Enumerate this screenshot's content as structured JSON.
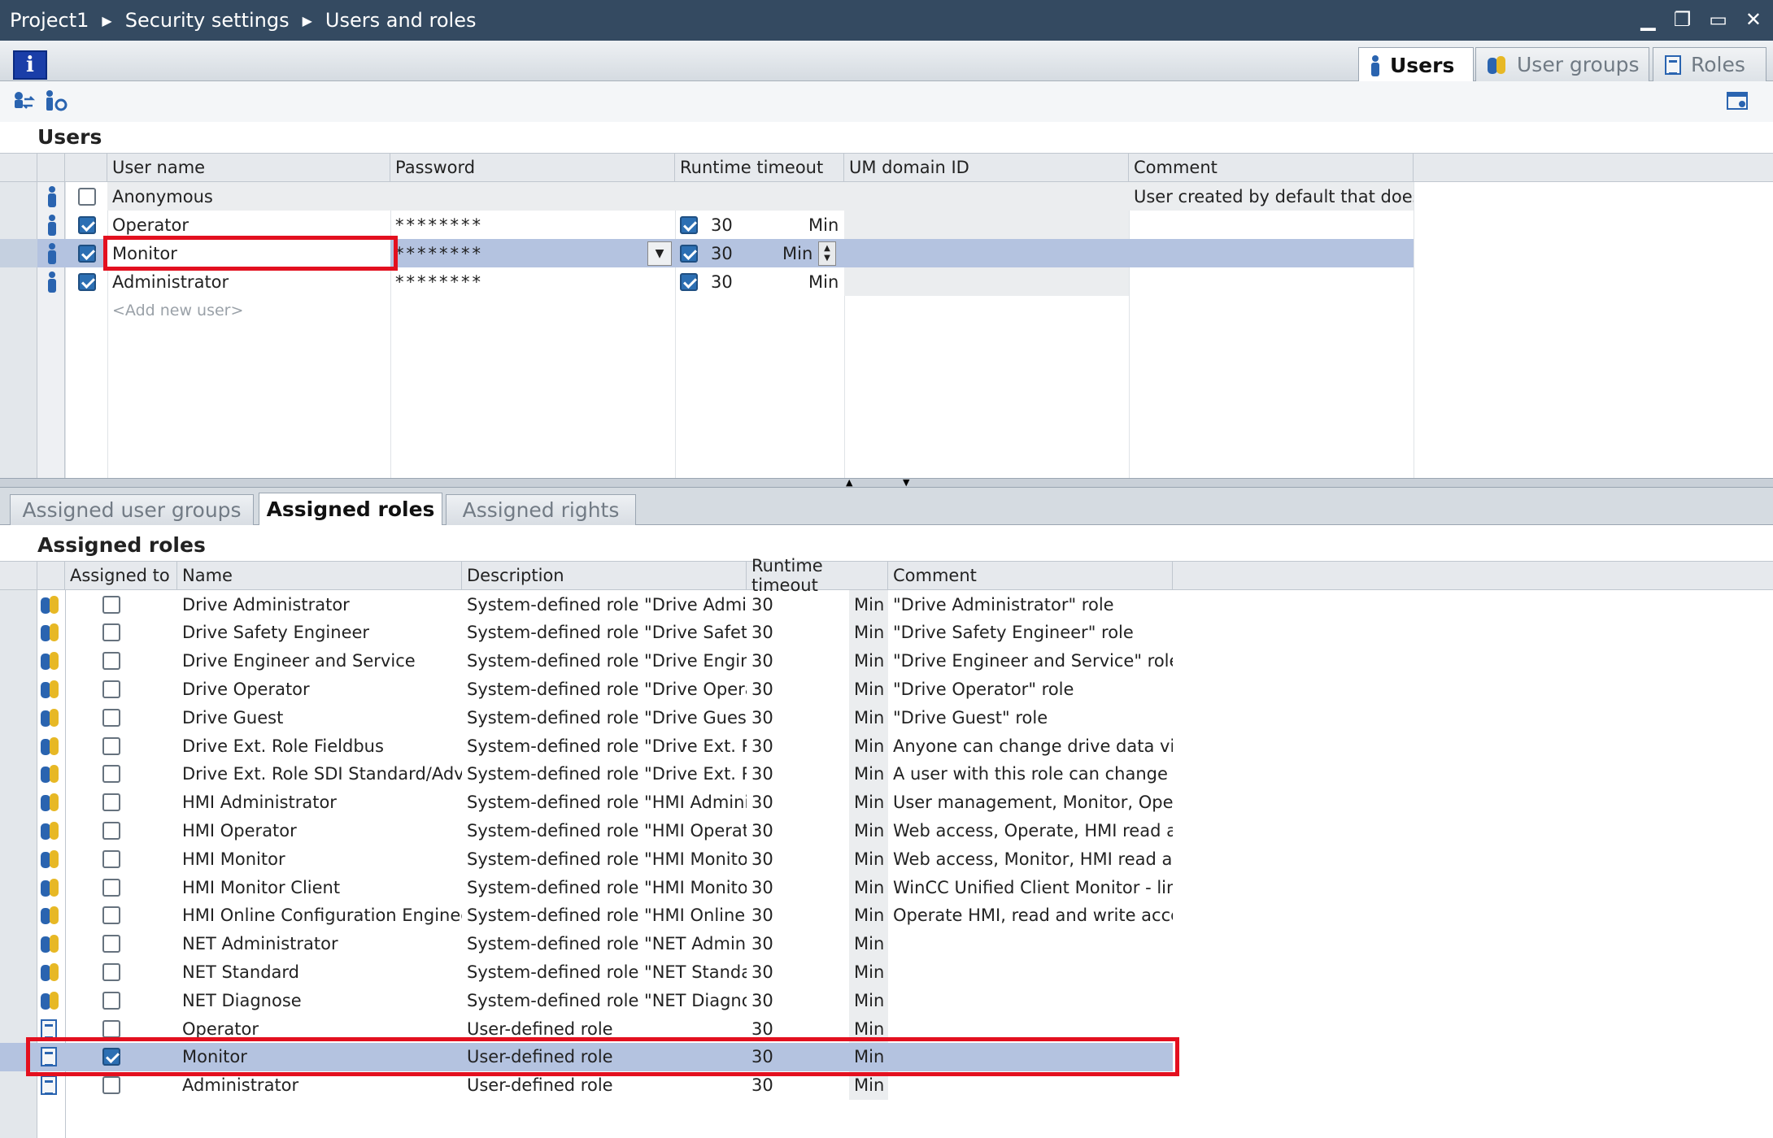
{
  "breadcrumb": [
    "Project1",
    "Security settings",
    "Users and roles"
  ],
  "window_controls": [
    "▁",
    "❐",
    "▭",
    "✕"
  ],
  "view_tabs": [
    {
      "label": "Users",
      "active": true
    },
    {
      "label": "User groups",
      "active": false
    },
    {
      "label": "Roles",
      "active": false
    }
  ],
  "info_label": "i",
  "users": {
    "title": "Users",
    "columns": [
      "User name",
      "Password",
      "Runtime timeout",
      "UM domain ID",
      "Comment"
    ],
    "rows": [
      {
        "name": "Anonymous",
        "checked": false,
        "password": "",
        "timeout_on": false,
        "timeout": "",
        "unit": "",
        "comment": "User created by default that does ..."
      },
      {
        "name": "Operator",
        "checked": true,
        "password": "********",
        "timeout_on": true,
        "timeout": "30",
        "unit": "Min",
        "comment": ""
      },
      {
        "name": "Monitor",
        "checked": true,
        "password": "********",
        "timeout_on": true,
        "timeout": "30",
        "unit": "Min",
        "comment": ""
      },
      {
        "name": "Administrator",
        "checked": true,
        "password": "********",
        "timeout_on": true,
        "timeout": "30",
        "unit": "Min",
        "comment": ""
      }
    ],
    "add_new": "<Add new user>"
  },
  "lower_tabs": [
    {
      "label": "Assigned user groups",
      "active": false
    },
    {
      "label": "Assigned roles",
      "active": true
    },
    {
      "label": "Assigned rights",
      "active": false
    }
  ],
  "roles": {
    "title": "Assigned roles",
    "columns": [
      "Assigned to",
      "Name",
      "Description",
      "Runtime timeout",
      "Comment"
    ],
    "rows": [
      {
        "icon": "system",
        "checked": false,
        "name": "Drive Administrator",
        "desc": "System-defined role \"Drive Admini...",
        "timeout": "30",
        "unit": "Min",
        "comment": "\"Drive Administrator\" role"
      },
      {
        "icon": "system",
        "checked": false,
        "name": "Drive Safety Engineer",
        "desc": "System-defined role \"Drive Safety ...",
        "timeout": "30",
        "unit": "Min",
        "comment": "\"Drive Safety Engineer\" role"
      },
      {
        "icon": "system",
        "checked": false,
        "name": "Drive Engineer and Service",
        "desc": "System-defined role \"Drive Engine...",
        "timeout": "30",
        "unit": "Min",
        "comment": "\"Drive Engineer and Service\" role"
      },
      {
        "icon": "system",
        "checked": false,
        "name": "Drive Operator",
        "desc": "System-defined role \"Drive Operat...",
        "timeout": "30",
        "unit": "Min",
        "comment": "\"Drive Operator\" role"
      },
      {
        "icon": "system",
        "checked": false,
        "name": "Drive Guest",
        "desc": "System-defined role \"Drive Guest\"",
        "timeout": "30",
        "unit": "Min",
        "comment": "\"Drive Guest\" role"
      },
      {
        "icon": "system",
        "checked": false,
        "name": "Drive Ext. Role Fieldbus",
        "desc": "System-defined role \"Drive Ext. Rol...",
        "timeout": "30",
        "unit": "Min",
        "comment": "Anyone can change drive data via..."
      },
      {
        "icon": "system",
        "checked": false,
        "name": "Drive Ext. Role SDI Standard/Adv",
        "desc": "System-defined role \"Drive Ext. Rol...",
        "timeout": "30",
        "unit": "Min",
        "comment": "A user with this role can change d..."
      },
      {
        "icon": "system",
        "checked": false,
        "name": "HMI Administrator",
        "desc": "System-defined role \"HMI Adminis...",
        "timeout": "30",
        "unit": "Min",
        "comment": "User management, Monitor, Oper..."
      },
      {
        "icon": "system",
        "checked": false,
        "name": "HMI Operator",
        "desc": "System-defined role \"HMI Operator\"",
        "timeout": "30",
        "unit": "Min",
        "comment": "Web access, Operate, HMI read an..."
      },
      {
        "icon": "system",
        "checked": false,
        "name": "HMI Monitor",
        "desc": "System-defined role \"HMI Monitor\"",
        "timeout": "30",
        "unit": "Min",
        "comment": "Web access, Monitor, HMI read ac..."
      },
      {
        "icon": "system",
        "checked": false,
        "name": "HMI Monitor Client",
        "desc": "System-defined role \"HMI Monitor ...",
        "timeout": "30",
        "unit": "Min",
        "comment": "WinCC Unified Client Monitor - limi..."
      },
      {
        "icon": "system",
        "checked": false,
        "name": "HMI Online Configuration Engineer",
        "desc": "System-defined role \"HMI Online C...",
        "timeout": "30",
        "unit": "Min",
        "comment": "Operate HMI, read and write acce..."
      },
      {
        "icon": "system",
        "checked": false,
        "name": "NET Administrator",
        "desc": "System-defined role \"NET Adminis...",
        "timeout": "30",
        "unit": "Min",
        "comment": ""
      },
      {
        "icon": "system",
        "checked": false,
        "name": "NET Standard",
        "desc": "System-defined role \"NET Standard\"",
        "timeout": "30",
        "unit": "Min",
        "comment": ""
      },
      {
        "icon": "system",
        "checked": false,
        "name": "NET Diagnose",
        "desc": "System-defined role \"NET Diagnos...",
        "timeout": "30",
        "unit": "Min",
        "comment": ""
      },
      {
        "icon": "user",
        "checked": false,
        "name": "Operator",
        "desc": "User-defined role",
        "timeout": "30",
        "unit": "Min",
        "comment": ""
      },
      {
        "icon": "user",
        "checked": true,
        "name": "Monitor",
        "desc": "User-defined role",
        "timeout": "30",
        "unit": "Min",
        "comment": "",
        "selected": true
      },
      {
        "icon": "user",
        "checked": false,
        "name": "Administrator",
        "desc": "User-defined role",
        "timeout": "30",
        "unit": "Min",
        "comment": ""
      }
    ]
  },
  "colors": {
    "titlebar": "#344a61",
    "highlight": "#e3101f",
    "selected_row": "#b4c3e0",
    "accent": "#2c6fb3"
  }
}
